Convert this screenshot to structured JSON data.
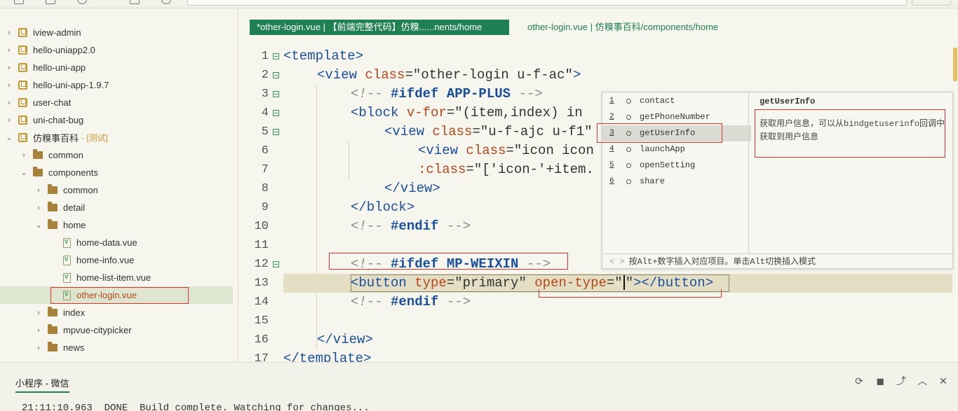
{
  "sidebar": {
    "items": [
      {
        "label": "iview-admin",
        "tag": ""
      },
      {
        "label": "hello-uniapp2.0",
        "tag": ""
      },
      {
        "label": "hello-uni-app",
        "tag": ""
      },
      {
        "label": "hello-uni-app-1.9.7",
        "tag": ""
      },
      {
        "label": "user-chat",
        "tag": ""
      },
      {
        "label": "uni-chat-bug",
        "tag": ""
      },
      {
        "label": "仿糗事百科",
        "tag": "- [测试]"
      },
      {
        "label": "common",
        "tag": ""
      },
      {
        "label": "components",
        "tag": ""
      },
      {
        "label": "common",
        "tag": ""
      },
      {
        "label": "detail",
        "tag": ""
      },
      {
        "label": "home",
        "tag": ""
      },
      {
        "label": "home-data.vue",
        "tag": ""
      },
      {
        "label": "home-info.vue",
        "tag": ""
      },
      {
        "label": "home-list-item.vue",
        "tag": ""
      },
      {
        "label": "other-login.vue",
        "tag": ""
      },
      {
        "label": "index",
        "tag": ""
      },
      {
        "label": "mpvue-citypicker",
        "tag": ""
      },
      {
        "label": "news",
        "tag": ""
      }
    ]
  },
  "editor": {
    "active_tab": "*other-login.vue | 【前端完整代码】仿糗......nents/home",
    "inactive_tab": "other-login.vue | 仿糗事百科/components/home",
    "line_numbers": [
      "1",
      "2",
      "3",
      "4",
      "5",
      "6",
      "7",
      "8",
      "9",
      "10",
      "11",
      "12",
      "13",
      "14",
      "15",
      "16",
      "17"
    ]
  },
  "code": {
    "l1_tag": "<template>",
    "l2_open": "<view ",
    "l2_attr": "class",
    "l2_val": "=\"other-login u-f-ac\"",
    "l2_close": ">",
    "l3_open": "<!-- ",
    "l3_kw": "#ifdef APP-PLUS",
    "l3_close": " -->",
    "l4_open": "<block ",
    "l4_attr": "v-for",
    "l4_val": "=\"(item,index) in",
    "l5_open": "<view ",
    "l5_attr": "class",
    "l5_val": "=\"u-f-ajc u-f1\"",
    "l6_open": "<view ",
    "l6_attr": "class",
    "l6_val": "=\"icon icon",
    "l7_attr": ":class",
    "l7_val": "=\"['icon-'+item.",
    "l8_tag": "</view>",
    "l9_tag": "</block>",
    "l10_open": "<!-- ",
    "l10_kw": "#endif",
    "l10_close": " -->",
    "l12_open": "<!-- ",
    "l12_kw": "#ifdef MP-WEIXIN",
    "l12_close": " -->",
    "l13_open": "<button ",
    "l13_attr1": "type",
    "l13_val1": "=\"primary\" ",
    "l13_attr2": "open-type",
    "l13_val2a": "=\"",
    "l13_val2b": "\"",
    "l13_close": "></button>",
    "l14_open": "<!-- ",
    "l14_kw": "#endif",
    "l14_close": " -->",
    "l16_tag": "</view>",
    "l17_tag": "</template>"
  },
  "autocomplete": {
    "items": [
      {
        "num": "1",
        "label": "contact"
      },
      {
        "num": "2",
        "label": "getPhoneNumber"
      },
      {
        "num": "3",
        "label": "getUserInfo"
      },
      {
        "num": "4",
        "label": "launchApp"
      },
      {
        "num": "5",
        "label": "openSetting"
      },
      {
        "num": "6",
        "label": "share"
      }
    ],
    "detail_title": "getUserInfo",
    "detail_desc": "获取用户信息，可以从bindgetuserinfo回调中获取到用户信息",
    "footer": "按Alt+数字插入对应项目。单击Alt切换插入模式",
    "footer_arrows": "< >"
  },
  "bottom": {
    "tab": "小程序 - 微信",
    "console": "21:11:10.963  DONE  Build complete. Watching for changes..."
  },
  "icons": {
    "restart": "restart-icon",
    "stop": "stop-icon",
    "export": "export-icon",
    "collapse": "chevron-up-icon",
    "close": "close-icon"
  },
  "colors": {
    "accent": "#1f8053",
    "highlight_box": "#e0342b",
    "tag_color": "#1a4f9c",
    "attr_color": "#b4481a"
  }
}
